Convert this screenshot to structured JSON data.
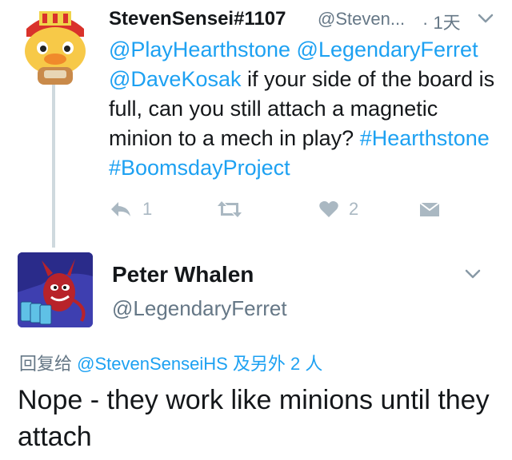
{
  "tweet1": {
    "name": "StevenSensei#1107",
    "handle": "@Steven...",
    "time": "· 1天",
    "text": {
      "mention1": "@PlayHearthstone",
      "mention2": "@LegendaryFerret",
      "mention3": "@DaveKosak",
      "body": " if your side of the board is full, can you still attach a magnetic minion to a mech in play?",
      "hashtag1": "#Hearthstone",
      "hashtag2": "#BoomsdayProject"
    },
    "actions": {
      "reply_count": "1",
      "like_count": "2"
    }
  },
  "tweet2": {
    "name": "Peter Whalen",
    "handle": "@LegendaryFerret",
    "reply_prefix": "回复给",
    "reply_to_handle": "@StevenSenseiHS",
    "reply_suffix": "及另外 2 人",
    "text": "Nope - they work like minions until they attach"
  },
  "colors": {
    "link": "#1da1f2",
    "secondary_text": "#657786",
    "action_icon": "#aab8c2"
  }
}
